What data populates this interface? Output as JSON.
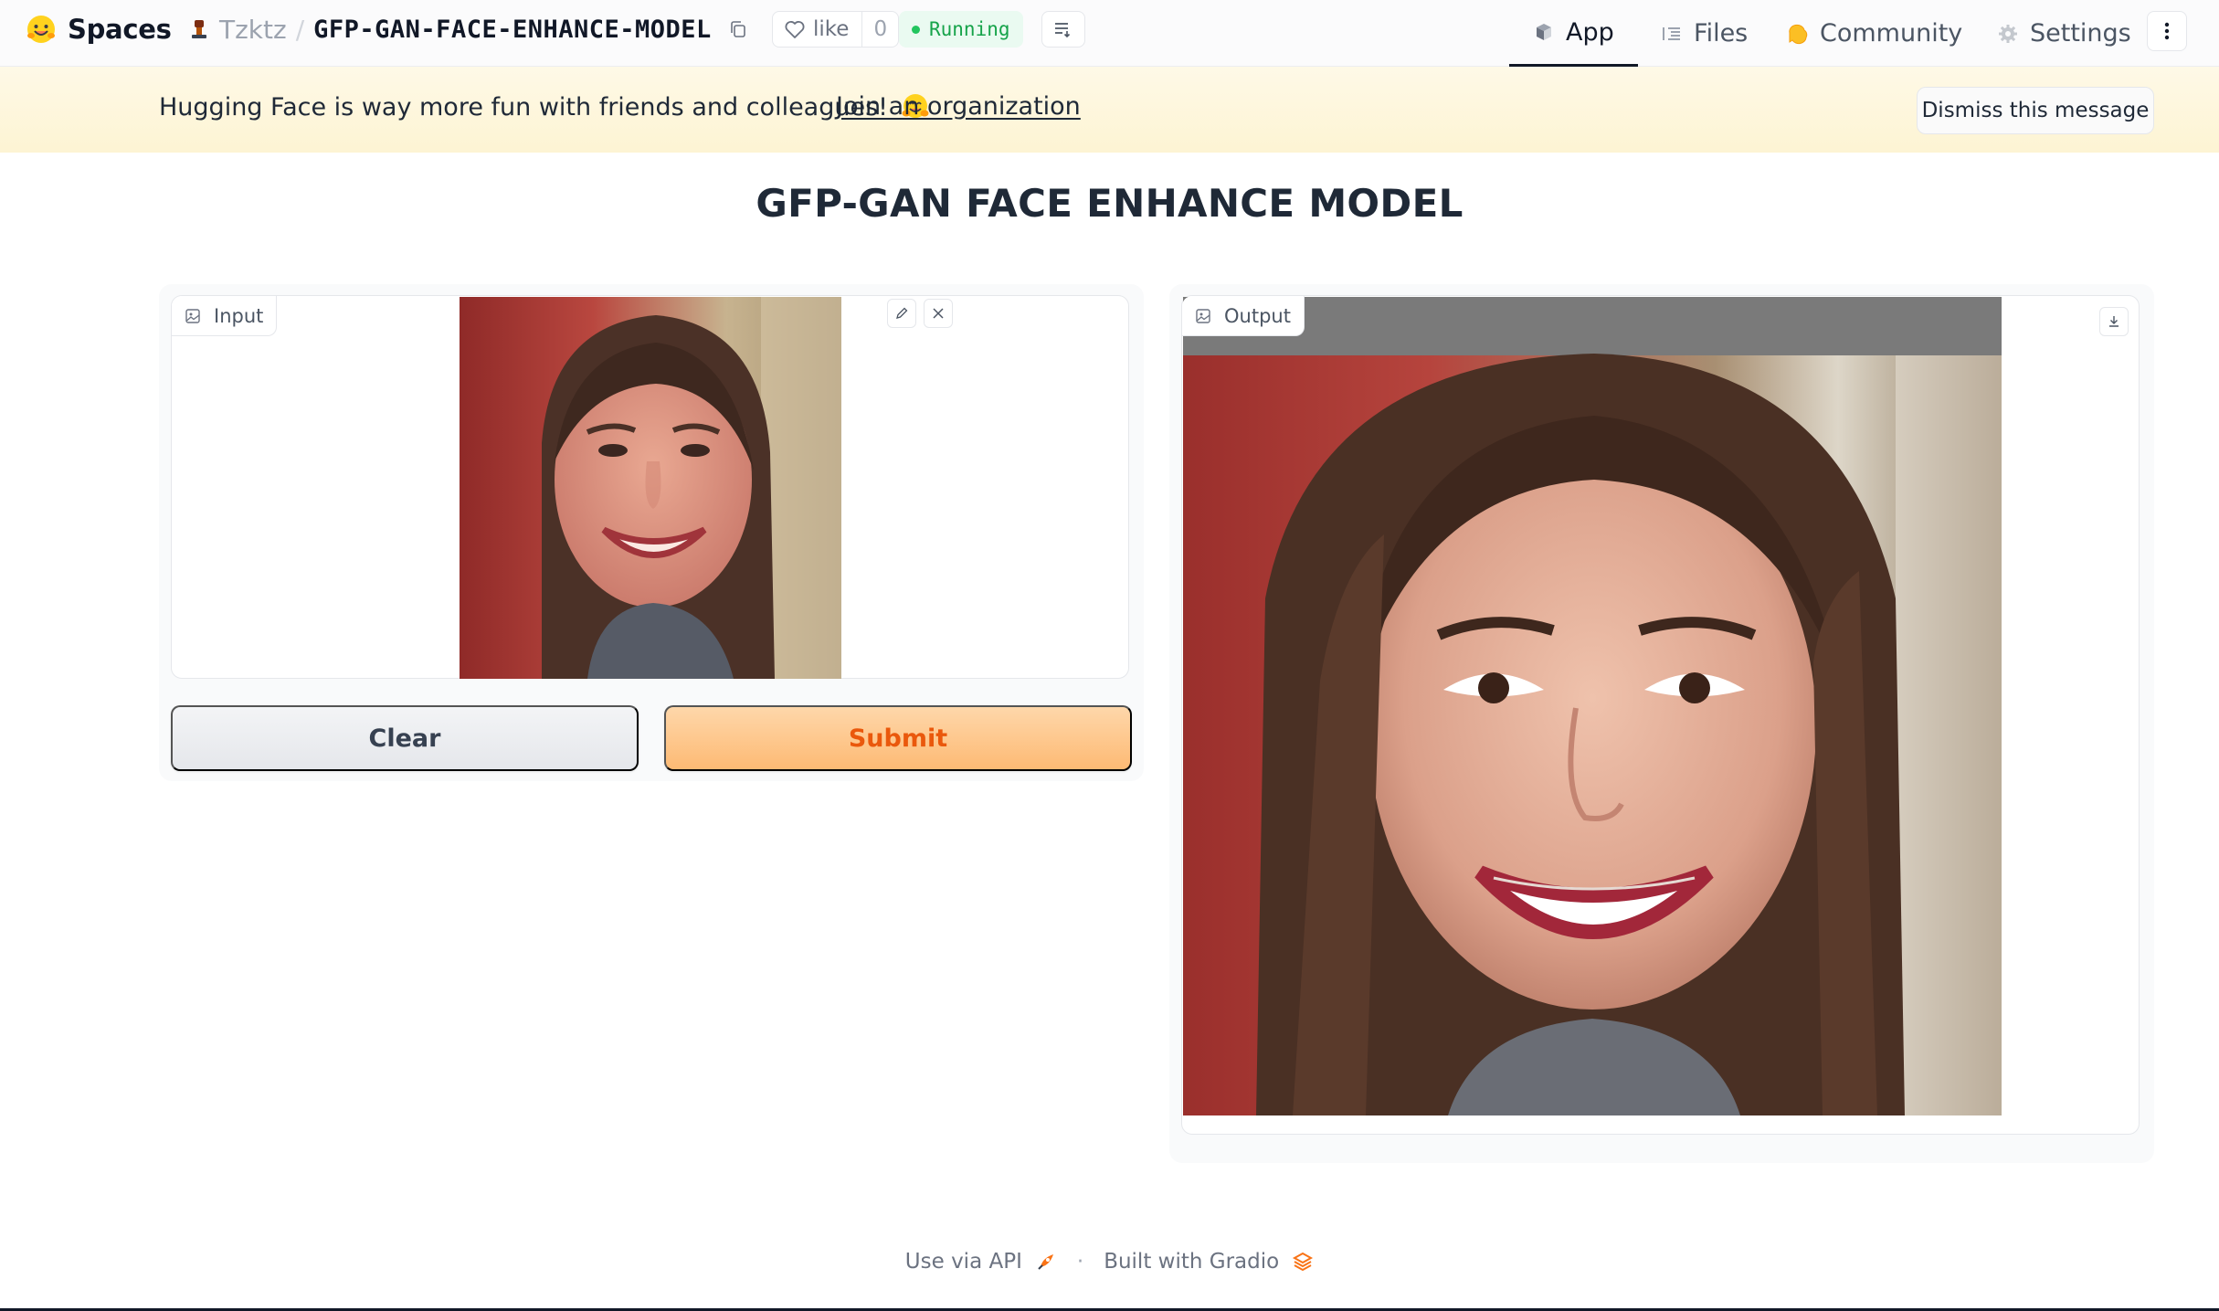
{
  "nav": {
    "brand": "Spaces",
    "owner": "Tzktz",
    "separator": "/",
    "repo": "GFP-GAN-FACE-ENHANCE-MODEL",
    "like_label": "like",
    "like_count": "0",
    "status": "Running",
    "tabs": [
      {
        "label": "App",
        "icon": "app-cube-icon",
        "active": true
      },
      {
        "label": "Files",
        "icon": "files-icon",
        "active": false
      },
      {
        "label": "Community",
        "icon": "community-icon",
        "active": false
      },
      {
        "label": "Settings",
        "icon": "gear-icon",
        "active": false
      }
    ]
  },
  "banner": {
    "message": "Hugging Face is way more fun with friends and colleagues!",
    "link": "Join an organization",
    "dismiss": "Dismiss this message"
  },
  "title": "GFP-GAN FACE ENHANCE MODEL",
  "input_panel": {
    "label": "Input",
    "clear": "Clear",
    "submit": "Submit"
  },
  "output_panel": {
    "label": "Output"
  },
  "footer": {
    "api": "Use via API",
    "separator": "·",
    "built": "Built with Gradio"
  },
  "colors": {
    "accent": "#ea580c",
    "status": "#16a34a",
    "banner_bg": "#fef9e7"
  }
}
